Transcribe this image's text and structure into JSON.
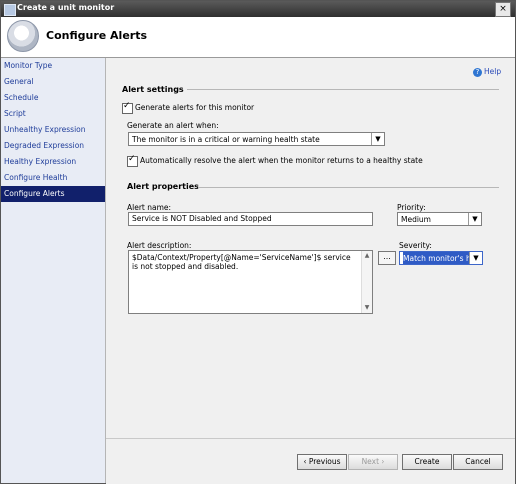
{
  "window": {
    "title": "Create a unit monitor",
    "close_symbol": "×"
  },
  "header": {
    "title": "Configure Alerts"
  },
  "sidebar": {
    "items": [
      {
        "label": "Monitor Type",
        "active": false
      },
      {
        "label": "General",
        "active": false
      },
      {
        "label": "Schedule",
        "active": false
      },
      {
        "label": "Script",
        "active": false
      },
      {
        "label": "Unhealthy Expression",
        "active": false
      },
      {
        "label": "Degraded Expression",
        "active": false
      },
      {
        "label": "Healthy Expression",
        "active": false
      },
      {
        "label": "Configure Health",
        "active": false
      },
      {
        "label": "Configure Alerts",
        "active": true
      }
    ]
  },
  "help": {
    "label": "Help",
    "icon_symbol": "?"
  },
  "alert_settings": {
    "section_title": "Alert settings",
    "generate_checkbox_label": "Generate alerts for this monitor",
    "generate_when_label": "Generate an alert when:",
    "generate_when_value": "The monitor is in a critical or warning health state",
    "auto_resolve_label": "Automatically resolve the alert when the monitor returns to a healthy state"
  },
  "alert_properties": {
    "section_title": "Alert properties",
    "name_label": "Alert name:",
    "name_value": "Service is NOT Disabled and Stopped",
    "priority_label": "Priority:",
    "priority_value": "Medium",
    "description_label": "Alert description:",
    "description_value": "$Data/Context/Property[@Name='ServiceName']$ service is not stopped and disabled.",
    "ellipsis_label": "...",
    "severity_label": "Severity:",
    "severity_value": "Match monitor's health"
  },
  "footer": {
    "previous_label": "Previous",
    "next_label": "Next",
    "create_label": "Create",
    "cancel_label": "Cancel"
  },
  "icons": {
    "dropdown": "▼",
    "scroll_up": "▲",
    "scroll_down": "▼"
  }
}
